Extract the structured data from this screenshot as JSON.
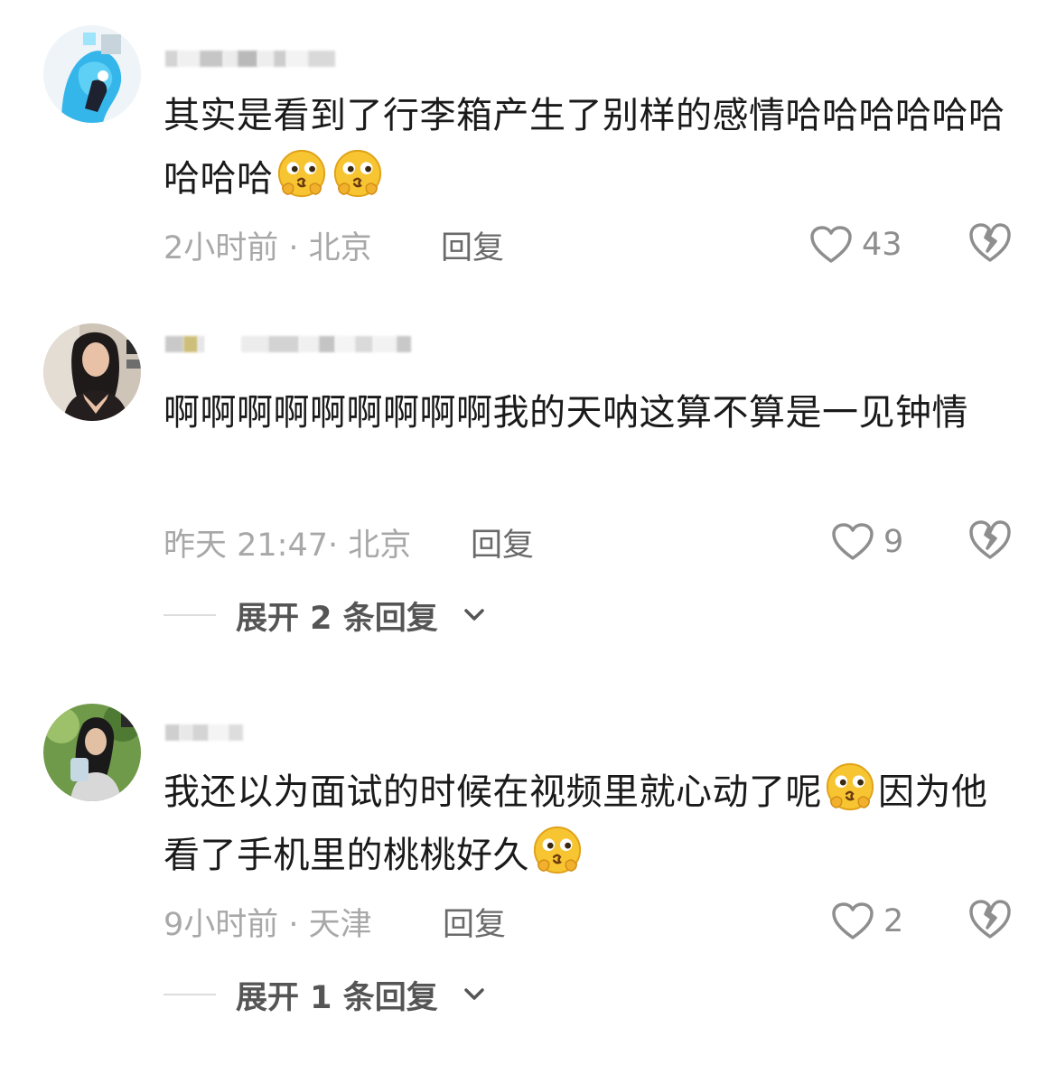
{
  "comments": [
    {
      "text_parts": [
        "其实是看到了行李箱产生了别样的感情哈哈哈哈哈哈哈哈哈",
        "",
        ""
      ],
      "time": "2小时前 · 北京",
      "reply_label": "回复",
      "likes": "43",
      "expand_label": ""
    },
    {
      "text_parts": [
        "啊啊啊啊啊啊啊啊啊我的天呐这算不算是一见钟情"
      ],
      "time": "昨天 21:47· 北京",
      "reply_label": "回复",
      "likes": "9",
      "expand_label": "展开 2 条回复"
    },
    {
      "text_parts": [
        "我还以为面试的时候在视频里就心动了呢",
        "因为他看了手机里的桃桃好久",
        ""
      ],
      "time": "9小时前 · 天津",
      "reply_label": "回复",
      "likes": "2",
      "expand_label": "展开 1 条回复"
    }
  ],
  "icons": {
    "emoji": "thinking-cute-emoji-icon",
    "like": "heart-outline-icon",
    "dislike": "broken-heart-icon",
    "expand": "chevron-down-icon"
  },
  "colors": {
    "text": "#1a1a1a",
    "meta": "#a8a8a8",
    "reply": "#6a6a6a",
    "emoji": "#f7c531"
  }
}
